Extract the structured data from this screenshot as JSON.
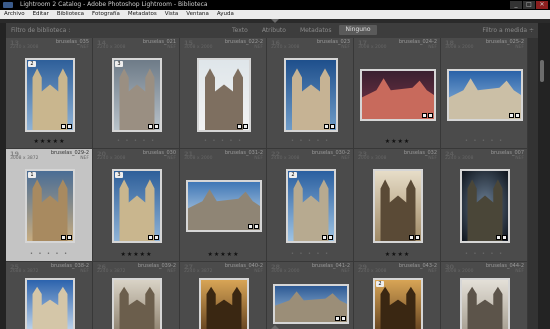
{
  "window": {
    "title": "Lightroom 2 Catalog - Adobe Photoshop Lightroom - Biblioteca",
    "controls": [
      "_",
      "□",
      "✕"
    ]
  },
  "menu": [
    "Archivo",
    "Editar",
    "Biblioteca",
    "Fotografía",
    "Metadatos",
    "Vista",
    "Ventana",
    "Ayuda"
  ],
  "filter_bar": {
    "title": "Filtro de biblioteca :",
    "options": [
      "Texto",
      "Atributo",
      "Metadatos",
      "Ninguno"
    ],
    "active_option": "Ninguno",
    "preset": "Filtro a medida ÷"
  },
  "colors": {
    "selected_cell": "#c4c4c4",
    "cell": "#4b4b4b",
    "background": "#333333"
  },
  "rows": [
    {
      "cells": [
        {
          "num": "13",
          "name": "bruselas_035",
          "dims": "2240 x 3008",
          "type": "NEF",
          "badge": "2",
          "stars": "★★★★★",
          "photo": "cathedral-facade-sky",
          "selected": false
        },
        {
          "num": "14",
          "name": "bruselas_021",
          "dims": "2240 x 3008",
          "type": "NEF",
          "badge": "3",
          "stars": "",
          "photo": "cathedral-facade-grey",
          "selected": false
        },
        {
          "num": "15",
          "name": "bruselas_022-2",
          "dims": "3008 x 2000",
          "type": "NEF",
          "badge": "",
          "stars": "",
          "photo": "cathedral-facade-pale",
          "selected": false
        },
        {
          "num": "16",
          "name": "bruselas_023",
          "dims": "2240 x 3008",
          "type": "NEF",
          "badge": "",
          "stars": "",
          "photo": "cathedral-towers-blue",
          "selected": false
        },
        {
          "num": "17",
          "name": "bruselas_024-2",
          "dims": "3008 x 2000",
          "type": "NEF",
          "badge": "",
          "stars": "★★★★",
          "photo": "red-building-dusk",
          "selected": false
        },
        {
          "num": "18",
          "name": "bruselas_025-2",
          "dims": "3008 x 2000",
          "type": "NEF",
          "badge": "",
          "stars": "",
          "photo": "cathedral-wide-blue",
          "selected": false
        }
      ]
    },
    {
      "cells": [
        {
          "num": "19",
          "name": "bruselas_029-2",
          "dims": "3008 x 3872",
          "type": "NEF",
          "badge": "1",
          "stars": "",
          "photo": "staircase-sepia",
          "selected": true
        },
        {
          "num": "20",
          "name": "bruselas_030",
          "dims": "2240 x 3008",
          "type": "NEF",
          "badge": "3",
          "stars": "★★★★★",
          "photo": "cathedral-facade-sky",
          "selected": false
        },
        {
          "num": "21",
          "name": "bruselas_031-2",
          "dims": "3008 x 2000",
          "type": "NEF",
          "badge": "",
          "stars": "★★★★★",
          "photo": "cathedral-side-blue",
          "selected": false
        },
        {
          "num": "22",
          "name": "bruselas_030-2",
          "dims": "2480 x 3008",
          "type": "NEF",
          "badge": "2",
          "stars": "",
          "photo": "cathedral-angle-blue",
          "selected": false
        },
        {
          "num": "23",
          "name": "bruselas_032",
          "dims": "2000 x 3008",
          "type": "NEF",
          "badge": "",
          "stars": "★★★★",
          "photo": "statue-sepia",
          "selected": false
        },
        {
          "num": "24",
          "name": "bruselas_007",
          "dims": "2240 x 3008",
          "type": "NEF",
          "badge": "",
          "stars": "",
          "photo": "cathedral-dark-vignette",
          "selected": false
        }
      ]
    },
    {
      "cells": [
        {
          "num": "25",
          "name": "bruselas_038-2",
          "dims": "2688 x 3872",
          "type": "NEF",
          "badge": "",
          "stars": "",
          "photo": "dome-blue",
          "selected": false
        },
        {
          "num": "26",
          "name": "bruselas_039-2",
          "dims": "2240 x 3872",
          "type": "NEF",
          "badge": "",
          "stars": "",
          "photo": "arch-pale",
          "selected": false
        },
        {
          "num": "27",
          "name": "bruselas_040-2",
          "dims": "2240 x 3872",
          "type": "NEF",
          "badge": "",
          "stars": "",
          "photo": "arch-warm",
          "selected": false
        },
        {
          "num": "28",
          "name": "bruselas_041-2",
          "dims": "3008 x 2000",
          "type": "NEF",
          "badge": "",
          "stars": "",
          "photo": "building-blue",
          "selected": false
        },
        {
          "num": "29",
          "name": "bruselas_043-2",
          "dims": "2240 x 3008",
          "type": "NEF",
          "badge": "2",
          "stars": "",
          "photo": "arch-warm",
          "selected": false
        },
        {
          "num": "30",
          "name": "bruselas_044-2",
          "dims": "3008 x 2000",
          "type": "NEF",
          "badge": "",
          "stars": "",
          "photo": "window-pale",
          "selected": false
        }
      ]
    }
  ]
}
